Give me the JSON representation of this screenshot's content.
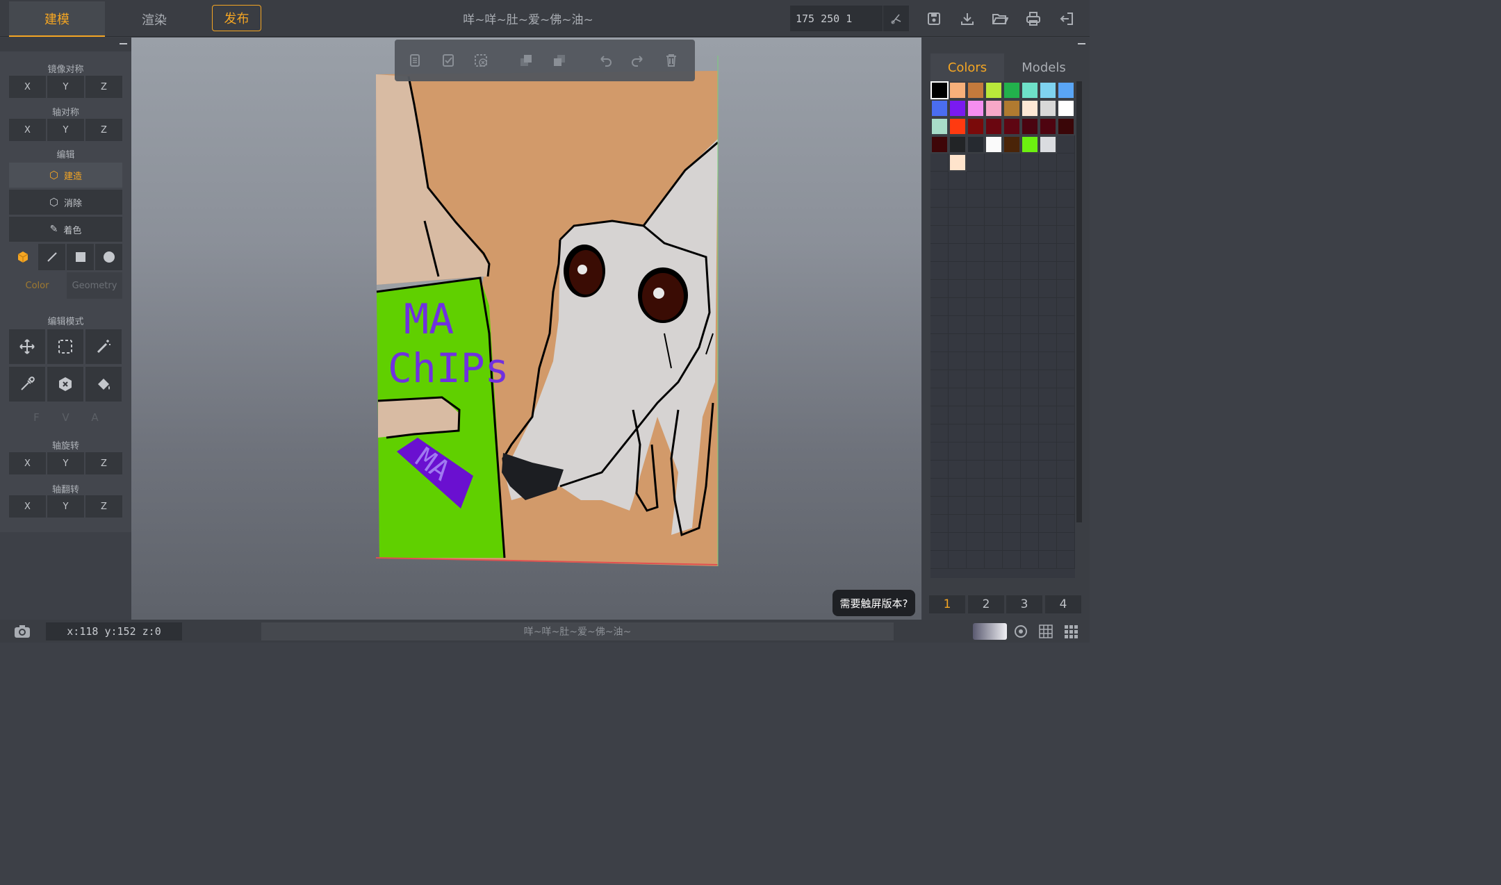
{
  "header": {
    "tabs": [
      {
        "label": "建模",
        "active": true
      },
      {
        "label": "渲染",
        "active": false
      }
    ],
    "publish_label": "发布",
    "title": "咩~咩~肚~爱~佛~油~",
    "dimensions_value": "175 250 1",
    "icons": [
      "scissors-icon",
      "save-icon",
      "download-icon",
      "open-folder-icon",
      "print-icon",
      "exit-icon"
    ]
  },
  "left_panel": {
    "mirror_label": "镜像对称",
    "axis_sym_label": "轴对称",
    "edit_label": "编辑",
    "build_label": "建造",
    "erase_label": "消除",
    "paint_label": "着色",
    "color_tab": "Color",
    "geometry_tab": "Geometry",
    "edit_mode_label": "编辑模式",
    "fva": [
      "F",
      "V",
      "A"
    ],
    "rotate_label": "轴旋转",
    "flip_label": "轴翻转",
    "axes": [
      "X",
      "Y",
      "Z"
    ]
  },
  "right_panel": {
    "colors_tab": "Colors",
    "models_tab": "Models",
    "palette": [
      "#000000",
      "#f7b07a",
      "#c47a3c",
      "#b9e83a",
      "#22b14c",
      "#6ee0c8",
      "#7fd3f0",
      "#5aa5f5",
      "#4a6df0",
      "#7a1af0",
      "#f58ef0",
      "#f7a8c8",
      "#b07a30",
      "#fde8d6",
      "#d8d8d8",
      "#ffffff",
      "#a8dcc8",
      "#ff3a10",
      "#7a0a0a",
      "#6a0610",
      "#5e0612",
      "#4a0410",
      "#4e0410",
      "#3a0608",
      "#3e0608",
      "#222426",
      "#262a30",
      "#fafafa",
      "#4a2408",
      "#6cf010",
      "#dadce0",
      "",
      "",
      "#ffe4cc",
      "",
      "",
      "",
      "",
      "",
      ""
    ],
    "pages": [
      "1",
      "2",
      "3",
      "4"
    ],
    "touch_tip": "需要触屏版本?"
  },
  "canvas": {
    "text_line1": "MA",
    "text_line2": "ChIPs",
    "text_label": "MA"
  },
  "status": {
    "coords": "x:118  y:152  z:0",
    "title": "咩~咩~肚~爱~佛~油~"
  },
  "colors": {
    "accent": "#f5a623",
    "panel": "#43464d",
    "bar": "#3a3d43"
  }
}
